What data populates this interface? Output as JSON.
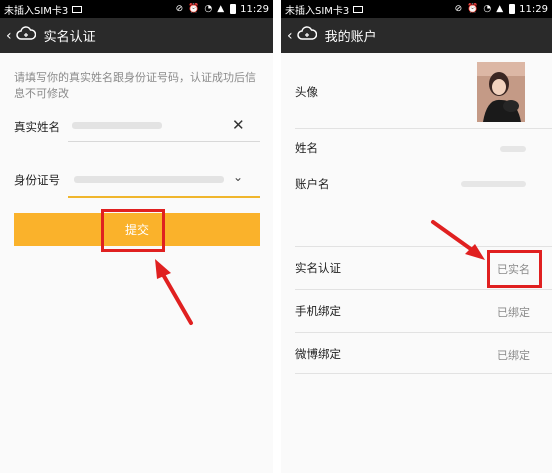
{
  "status_bar": {
    "carrier": "未插入SIM卡3",
    "time": "11:29"
  },
  "left_screen": {
    "title": "实名认证",
    "hint": "请填写你的真实姓名跟身份证号码，认证成功后信息不可修改",
    "name_label": "真实姓名",
    "id_label": "身份证号",
    "submit_label": "提交"
  },
  "right_screen": {
    "title": "我的账户",
    "avatar_label": "头像",
    "name_label": "姓名",
    "account_label": "账户名",
    "realname_label": "实名认证",
    "realname_value": "已实名",
    "phone_label": "手机绑定",
    "phone_value": "已绑定",
    "weibo_label": "微博绑定",
    "weibo_value": "已绑定"
  },
  "colors": {
    "accent": "#fab22b",
    "highlight": "#e02020",
    "titlebar": "#2a2a2a"
  },
  "icons": [
    "back-icon",
    "cloud-icon",
    "clear-icon",
    "chevron-down-icon",
    "arrow-icon"
  ]
}
